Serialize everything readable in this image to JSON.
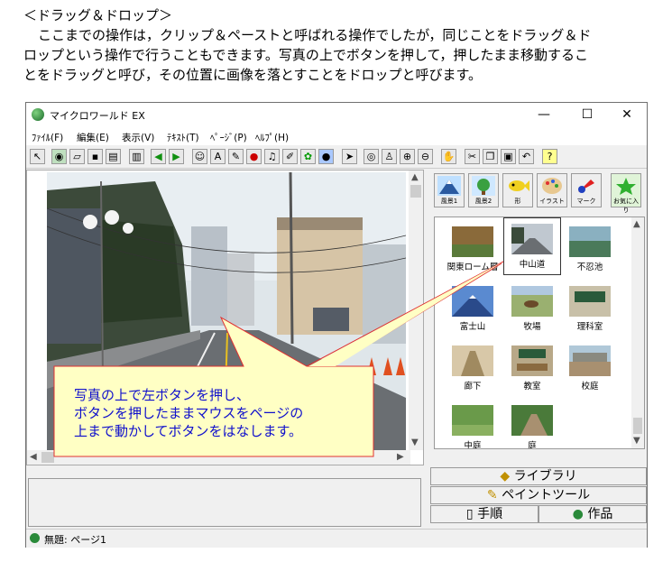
{
  "doc": {
    "heading": "＜ドラッグ＆ドロップ＞",
    "para_line1": "ここまでの操作は，クリップ＆ペーストと呼ばれる操作でしたが，同じことをドラッグ＆ド",
    "para_line2": "ロップという操作で行うこともできます。写真の上でボタンを押して，押したまま移動するこ",
    "para_line3": "とをドラッグと呼び，その位置に画像を落とすことをドロップと呼びます。"
  },
  "window": {
    "title": "マイクロワールド EX",
    "minimize": "—",
    "maximize": "☐",
    "close": "✕"
  },
  "menu": [
    "ﾌｧｲﾙ(F)",
    "編集(E)",
    "表示(V)",
    "ﾃｷｽﾄ(T)",
    "ﾍﾟｰｼﾞ(P)",
    "ﾍﾙﾌﾟ(H)"
  ],
  "categories": [
    "風景1",
    "風景2",
    "形",
    "イラスト",
    "マーク",
    "お気に入り"
  ],
  "library_items": [
    "関東ローム層",
    "中山道",
    "不忍池",
    "富士山",
    "牧場",
    "理科室",
    "廊下",
    "教室",
    "校庭",
    "中庭",
    "庭"
  ],
  "tabs": {
    "library": "ライブラリ",
    "paint": "ペイントツール",
    "steps": "手順",
    "works": "作品"
  },
  "status": {
    "page": "無題: ページ1"
  },
  "callout": {
    "line1": "写真の上で左ボタンを押し、",
    "line2": "ボタンを押したままマウスをページの",
    "line3": "上まで動かしてボタンをはなします。"
  },
  "colors": {
    "callout_fill": "#ffffc4",
    "callout_stroke": "#e03030",
    "callout_text": "#1010cc"
  }
}
